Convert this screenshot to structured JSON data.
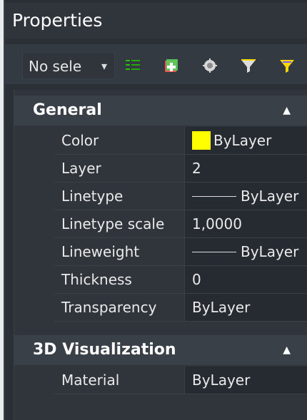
{
  "panel": {
    "title": "Properties",
    "selection": "No sele",
    "colors": {
      "background": "#2b3036",
      "section": "#3a4047",
      "text": "#eaeaea",
      "swatch_yellow": "#ffff00"
    }
  },
  "toolbar": {
    "icons": [
      "select-objects-icon",
      "add-to-selection-icon",
      "quick-select-icon",
      "filter-icon",
      "filter-settings-icon"
    ]
  },
  "sections": {
    "general": {
      "title": "General",
      "rows": {
        "color": {
          "label": "Color",
          "value": "ByLayer"
        },
        "layer": {
          "label": "Layer",
          "value": "2"
        },
        "linetype": {
          "label": "Linetype",
          "value": "ByLayer"
        },
        "linetype_scale": {
          "label": "Linetype scale",
          "value": "1,0000"
        },
        "lineweight": {
          "label": "Lineweight",
          "value": "ByLayer"
        },
        "thickness": {
          "label": "Thickness",
          "value": "0"
        },
        "transparency": {
          "label": "Transparency",
          "value": "ByLayer"
        }
      }
    },
    "visualization": {
      "title": "3D Visualization",
      "rows": {
        "material": {
          "label": "Material",
          "value": "ByLayer"
        }
      }
    }
  }
}
